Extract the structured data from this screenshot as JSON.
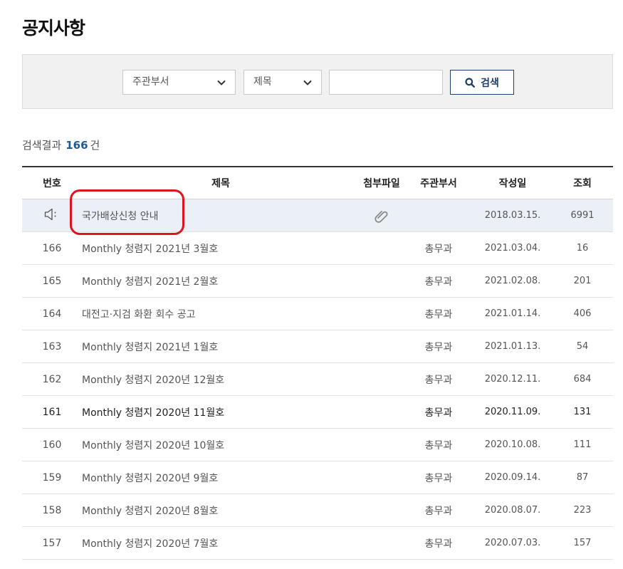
{
  "page": {
    "title": "공지사항"
  },
  "search": {
    "dept_select": "주관부서",
    "field_select": "제목",
    "query_value": "",
    "button_label": "검색"
  },
  "results": {
    "label": "검색결과",
    "count": "166",
    "unit": "건"
  },
  "table": {
    "headers": {
      "num": "번호",
      "title": "제목",
      "file": "첨부파일",
      "dept": "주관부서",
      "date": "작성일",
      "views": "조회"
    },
    "notice": {
      "icon": "megaphone-icon",
      "title": "국가배상신청 안내",
      "attachment_icon": "paperclip-icon",
      "dept": "",
      "date": "2018.03.15.",
      "views": "6991"
    },
    "rows": [
      {
        "num": "166",
        "title": "Monthly 청렴지 2021년 3월호",
        "dept": "총무과",
        "date": "2021.03.04.",
        "views": "16"
      },
      {
        "num": "165",
        "title": "Monthly 청렴지 2021년 2월호",
        "dept": "총무과",
        "date": "2021.02.08.",
        "views": "201"
      },
      {
        "num": "164",
        "title": "대전고·지검 화환 회수 공고",
        "dept": "총무과",
        "date": "2021.01.14.",
        "views": "406"
      },
      {
        "num": "163",
        "title": "Monthly 청렴지 2021년 1월호",
        "dept": "총무과",
        "date": "2021.01.13.",
        "views": "54"
      },
      {
        "num": "162",
        "title": "Monthly 청렴지 2020년 12월호",
        "dept": "총무과",
        "date": "2020.12.11.",
        "views": "684"
      },
      {
        "num": "161",
        "title": "Monthly 청렴지 2020년 11월호",
        "dept": "총무과",
        "date": "2020.11.09.",
        "views": "131"
      },
      {
        "num": "160",
        "title": "Monthly 청렴지 2020년 10월호",
        "dept": "총무과",
        "date": "2020.10.08.",
        "views": "111"
      },
      {
        "num": "159",
        "title": "Monthly 청렴지 2020년 9월호",
        "dept": "총무과",
        "date": "2020.09.14.",
        "views": "87"
      },
      {
        "num": "158",
        "title": "Monthly 청렴지 2020년 8월호",
        "dept": "총무과",
        "date": "2020.08.07.",
        "views": "223"
      },
      {
        "num": "157",
        "title": "Monthly 청렴지 2020년 7월호",
        "dept": "총무과",
        "date": "2020.07.03.",
        "views": "157"
      }
    ]
  },
  "colors": {
    "accent": "#1d5a9a",
    "button_border": "#1e3f66",
    "notice_bg": "#eaf0f5",
    "highlight": "#e0141e"
  }
}
